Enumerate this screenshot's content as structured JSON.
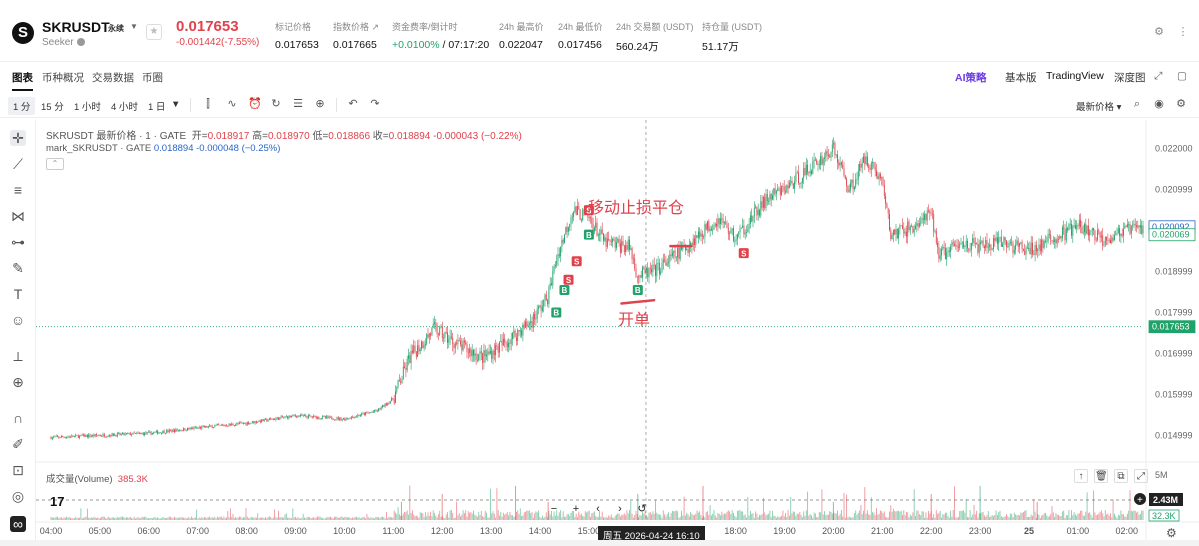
{
  "header": {
    "symbol": "SKRUSDT",
    "contract_type": "永续",
    "subtitle": "Seeker",
    "last_price": "0.017653",
    "change": "-0.001442(-7.55%)",
    "stats": [
      {
        "label": "标记价格",
        "value": "0.017653"
      },
      {
        "label": "指数价格 ↗",
        "value": "0.017665"
      },
      {
        "label": "资金费率/倒计时",
        "value_green": "+0.0100%",
        "value_rest": " / 07:17:20"
      },
      {
        "label": "24h 最高价",
        "value": "0.022047"
      },
      {
        "label": "24h 最低价",
        "value": "0.017456"
      },
      {
        "label": "24h 交易额 (USDT)",
        "value": "560.24万"
      },
      {
        "label": "持仓量 (USDT)",
        "value": "51.17万"
      }
    ]
  },
  "tabs": {
    "left": [
      "图表",
      "币种概况",
      "交易数据",
      "币圈"
    ],
    "ai_prefix": "AI",
    "strategy": "策略",
    "basic": "基本版",
    "tradingview": "TradingView",
    "depth": "深度图"
  },
  "toolbar": {
    "intervals": [
      "1 分",
      "15 分",
      "1 小时",
      "4 小时",
      "1 日"
    ],
    "price_type": "最新价格"
  },
  "legend": {
    "main_name": "SKRUSDT 最新价格 · 1 · GATE",
    "open_label": "开=",
    "open": "0.018917",
    "high_label": "高=",
    "high": "0.018970",
    "low_label": "低=",
    "low": "0.018866",
    "close_label": "收=",
    "close": "0.018894",
    "chg": "-0.000043 (−0.22%)",
    "mark_name": "mark_SKRUSDT · GATE",
    "mark_value": "0.018894",
    "mark_chg": "-0.000048 (−0.25%)"
  },
  "volume": {
    "label": "成交量(Volume)",
    "value": "385.3K",
    "axis_max": "5M",
    "axis_tag": "2.43M",
    "last_tag": "32.3K"
  },
  "crosshair_date": "周五 2026-04-24  16:10",
  "annotations": {
    "trailing_stop": "移动止损平仓",
    "open_position": "开单"
  },
  "colors": {
    "up": "#21a26b",
    "down": "#e0424c",
    "accent": "#6c3ce0"
  },
  "chart_data": {
    "type": "candlestick",
    "x_ticks": [
      "04:00",
      "05:00",
      "06:00",
      "07:00",
      "08:00",
      "09:00",
      "10:00",
      "11:00",
      "12:00",
      "13:00",
      "14:00",
      "15:00",
      "16:00",
      "17:00",
      "18:00",
      "19:00",
      "20:00",
      "21:00",
      "22:00",
      "23:00",
      "25",
      "01:00",
      "02:00"
    ],
    "y_ticks": [
      "0.022000",
      "0.020999",
      "0.019999",
      "0.018999",
      "0.017999",
      "0.016999",
      "0.015999",
      "0.014999"
    ],
    "ylim": [
      0.0143,
      0.0227
    ],
    "price_tags": [
      {
        "value": "0.020092",
        "style": "blue"
      },
      {
        "value": "0.020069",
        "style": "green"
      },
      {
        "value": "0.017653",
        "style": "green-filled"
      }
    ],
    "price_path_points": [
      [
        "04:00",
        0.01495
      ],
      [
        "05:00",
        0.015
      ],
      [
        "06:00",
        0.01505
      ],
      [
        "07:00",
        0.01518
      ],
      [
        "08:00",
        0.0153
      ],
      [
        "09:00",
        0.01548
      ],
      [
        "10:00",
        0.0154
      ],
      [
        "10:40",
        0.0156
      ],
      [
        "11:00",
        0.0159
      ],
      [
        "11:20",
        0.0169
      ],
      [
        "11:50",
        0.0176
      ],
      [
        "12:20",
        0.0172
      ],
      [
        "12:50",
        0.0169
      ],
      [
        "13:20",
        0.0173
      ],
      [
        "13:50",
        0.0178
      ],
      [
        "14:10",
        0.0184
      ],
      [
        "14:20",
        0.0193
      ],
      [
        "14:40",
        0.0205
      ],
      [
        "15:00",
        0.0203
      ],
      [
        "15:20",
        0.0197
      ],
      [
        "15:50",
        0.0196
      ],
      [
        "16:00",
        0.0189
      ],
      [
        "16:20",
        0.019
      ],
      [
        "16:40",
        0.0193
      ],
      [
        "17:00",
        0.0196
      ],
      [
        "17:20",
        0.02
      ],
      [
        "17:40",
        0.0203
      ],
      [
        "18:00",
        0.0198
      ],
      [
        "18:20",
        0.0203
      ],
      [
        "18:40",
        0.0208
      ],
      [
        "19:00",
        0.021
      ],
      [
        "19:30",
        0.0215
      ],
      [
        "20:00",
        0.022
      ],
      [
        "20:20",
        0.021
      ],
      [
        "20:40",
        0.0218
      ],
      [
        "21:00",
        0.0212
      ],
      [
        "21:10",
        0.0199
      ],
      [
        "21:40",
        0.0201
      ],
      [
        "22:00",
        0.0204
      ],
      [
        "22:10",
        0.0194
      ],
      [
        "22:40",
        0.0197
      ],
      [
        "23:00",
        0.0196
      ],
      [
        "23:30",
        0.0197
      ],
      [
        "00:00",
        0.0195
      ],
      [
        "00:30",
        0.0198
      ],
      [
        "01:00",
        0.0201
      ],
      [
        "01:30",
        0.0198
      ],
      [
        "02:00",
        0.02
      ],
      [
        "02:20",
        0.02009
      ]
    ],
    "markers": [
      {
        "x": "14:20",
        "y": 0.018,
        "label": "B",
        "type": "buy"
      },
      {
        "x": "14:30",
        "y": 0.01855,
        "label": "B",
        "type": "buy"
      },
      {
        "x": "14:35",
        "y": 0.0188,
        "label": "S",
        "type": "sell"
      },
      {
        "x": "14:45",
        "y": 0.01925,
        "label": "S",
        "type": "sell"
      },
      {
        "x": "15:00",
        "y": 0.0199,
        "label": "B",
        "type": "buy"
      },
      {
        "x": "15:00",
        "y": 0.0205,
        "label": "S",
        "type": "sell"
      },
      {
        "x": "16:00",
        "y": 0.01855,
        "label": "B",
        "type": "buy"
      },
      {
        "x": "18:10",
        "y": 0.01945,
        "label": "S",
        "type": "sell"
      }
    ]
  }
}
